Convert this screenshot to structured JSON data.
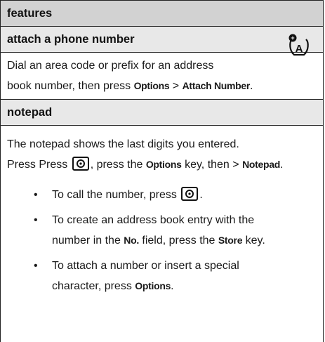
{
  "header": {
    "title": "features"
  },
  "sections": [
    {
      "title": "attach a phone number",
      "icon": "network-feature-icon",
      "lines": [
        "Dial an area code or prefix for an address",
        {
          "pre": "book number, then press ",
          "k1": "Options",
          "sep": " > ",
          "k2": "Attach Number",
          "post": "."
        }
      ]
    },
    {
      "title": "notepad",
      "intro1": "The notepad shows the last digits you entered.",
      "intro2": {
        "pre": "Press Press ",
        "icon": "send-key-icon",
        "mid": ", press the ",
        "k1": "Options",
        "mid2": " key, then > ",
        "k2": "Notepad",
        "post": "."
      },
      "bullets": [
        {
          "pre": "To call the number, press ",
          "icon": "send-key-icon",
          "post": "."
        },
        {
          "line1": "To create an address book entry with the",
          "pre2": "number in the ",
          "k1": "No.",
          "mid2": " field, press the ",
          "k2": "Store",
          "post2": " key."
        },
        {
          "line1": "To attach a number or insert a special",
          "pre2": "character, press ",
          "k1": "Options",
          "post2": "."
        }
      ]
    }
  ]
}
